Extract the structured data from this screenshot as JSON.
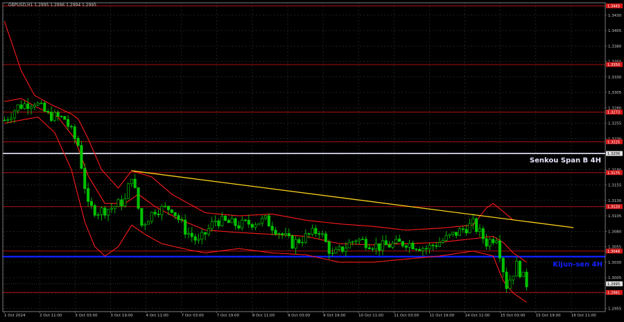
{
  "header": {
    "symbol_line": "GBPUSD,H1  1.2995 1.2996 1.2994 1.2995"
  },
  "colors": {
    "background": "#000000",
    "grid": "#2e3a2e",
    "axis": "#9a9a9a",
    "text": "#c8c8c8",
    "bull": "#00e000",
    "bear": "#00c000",
    "bollinger": "#ff1a1a",
    "level_line": "#b01010",
    "trend_line": "#ffd21a",
    "senkou": "#e6e6ff",
    "kijun": "#1020ff",
    "current_price_bg": "#e0e0e0",
    "level_label_bg": "#d01818"
  },
  "chart_data": {
    "type": "candlestick",
    "title": "GBPUSD,H1",
    "ylim": [
      1.295,
      1.345
    ],
    "y_ticks": [
      "1.3430",
      "1.3405",
      "1.3380",
      "1.3355",
      "1.3330",
      "1.3305",
      "1.3280",
      "1.3255",
      "1.3230",
      "1.3205",
      "1.3180",
      "1.3155",
      "1.3130",
      "1.3105",
      "1.3080",
      "1.3055",
      "1.3030",
      "1.3005",
      "1.2980",
      "1.2955"
    ],
    "x_ticks": [
      "1 Oct 2024",
      "2 Oct 11:00",
      "3 Oct 03:00",
      "3 Oct 19:00",
      "4 Oct 11:00",
      "7 Oct 03:00",
      "7 Oct 19:00",
      "8 Oct 11:00",
      "9 Oct 03:00",
      "9 Oct 19:00",
      "10 Oct 11:00",
      "11 Oct 03:00",
      "11 Oct 19:00",
      "14 Oct 11:00",
      "15 Oct 03:00",
      "15 Oct 19:00",
      "16 Oct 11:00"
    ],
    "levels": [
      {
        "price": 1.3445,
        "label": "1.3445"
      },
      {
        "price": 1.335,
        "label": "1.3350"
      },
      {
        "price": 1.3273,
        "label": "1.3273"
      },
      {
        "price": 1.3225,
        "label": "1.3225"
      },
      {
        "price": 1.3175,
        "label": "1.3175"
      },
      {
        "price": 1.312,
        "label": "1.3120"
      },
      {
        "price": 1.3048,
        "label": "1.3048"
      },
      {
        "price": 1.2981,
        "label": "1.2981"
      }
    ],
    "senkou_span_b": {
      "price": 1.3206,
      "name": "Senkou Span B 4H",
      "label": "1.3206"
    },
    "kijun_sen": {
      "price": 1.3039,
      "name": "Kijun-sen 4H"
    },
    "current_price": "1.2995",
    "trend_line": [
      {
        "i": 38,
        "p": 1.3178
      },
      {
        "i": 170,
        "p": 1.3086
      }
    ],
    "n_bars": 180,
    "close_anchors": [
      [
        0,
        1.326
      ],
      [
        4,
        1.3282
      ],
      [
        9,
        1.329
      ],
      [
        13,
        1.3268
      ],
      [
        18,
        1.3262
      ],
      [
        22,
        1.322
      ],
      [
        25,
        1.312
      ],
      [
        28,
        1.3112
      ],
      [
        32,
        1.3118
      ],
      [
        36,
        1.313
      ],
      [
        38,
        1.3172
      ],
      [
        41,
        1.309
      ],
      [
        45,
        1.3115
      ],
      [
        50,
        1.3118
      ],
      [
        54,
        1.3082
      ],
      [
        58,
        1.3062
      ],
      [
        63,
        1.3098
      ],
      [
        70,
        1.309
      ],
      [
        78,
        1.3098
      ],
      [
        86,
        1.306
      ],
      [
        94,
        1.3082
      ],
      [
        98,
        1.304
      ],
      [
        105,
        1.3068
      ],
      [
        112,
        1.3055
      ],
      [
        120,
        1.3062
      ],
      [
        126,
        1.3052
      ],
      [
        132,
        1.3068
      ],
      [
        140,
        1.3092
      ],
      [
        144,
        1.3062
      ],
      [
        147,
        1.3072
      ],
      [
        150,
        1.2992
      ],
      [
        153,
        1.3025
      ],
      [
        156,
        1.2995
      ]
    ],
    "bollinger_upper": [
      [
        0,
        1.342
      ],
      [
        5,
        1.334
      ],
      [
        9,
        1.33
      ],
      [
        14,
        1.3285
      ],
      [
        20,
        1.327
      ],
      [
        22,
        1.3262
      ],
      [
        25,
        1.323
      ],
      [
        29,
        1.318
      ],
      [
        34,
        1.315
      ],
      [
        38,
        1.3178
      ],
      [
        44,
        1.3168
      ],
      [
        50,
        1.314
      ],
      [
        55,
        1.3125
      ],
      [
        60,
        1.311
      ],
      [
        70,
        1.3105
      ],
      [
        80,
        1.3108
      ],
      [
        90,
        1.3098
      ],
      [
        100,
        1.3092
      ],
      [
        110,
        1.3088
      ],
      [
        120,
        1.3082
      ],
      [
        130,
        1.3085
      ],
      [
        140,
        1.309
      ],
      [
        144,
        1.3118
      ],
      [
        146,
        1.3125
      ],
      [
        149,
        1.3112
      ],
      [
        152,
        1.3098
      ]
    ],
    "bollinger_lower": [
      [
        0,
        1.3255
      ],
      [
        5,
        1.326
      ],
      [
        10,
        1.3265
      ],
      [
        15,
        1.324
      ],
      [
        20,
        1.318
      ],
      [
        24,
        1.3095
      ],
      [
        27,
        1.3055
      ],
      [
        30,
        1.304
      ],
      [
        34,
        1.3055
      ],
      [
        38,
        1.309
      ],
      [
        42,
        1.3075
      ],
      [
        47,
        1.306
      ],
      [
        55,
        1.305
      ],
      [
        60,
        1.3045
      ],
      [
        70,
        1.3052
      ],
      [
        80,
        1.3045
      ],
      [
        90,
        1.3042
      ],
      [
        100,
        1.303
      ],
      [
        110,
        1.303
      ],
      [
        120,
        1.3035
      ],
      [
        130,
        1.304
      ],
      [
        140,
        1.3048
      ],
      [
        146,
        1.304
      ],
      [
        149,
        1.3
      ],
      [
        152,
        1.298
      ],
      [
        156,
        1.2965
      ]
    ],
    "bollinger_middle": [
      [
        0,
        1.329
      ],
      [
        5,
        1.3295
      ],
      [
        10,
        1.328
      ],
      [
        16,
        1.3265
      ],
      [
        21,
        1.323
      ],
      [
        25,
        1.317
      ],
      [
        30,
        1.3125
      ],
      [
        36,
        1.3125
      ],
      [
        40,
        1.314
      ],
      [
        45,
        1.312
      ],
      [
        52,
        1.31
      ],
      [
        60,
        1.3082
      ],
      [
        70,
        1.3078
      ],
      [
        80,
        1.3075
      ],
      [
        90,
        1.3072
      ],
      [
        100,
        1.306
      ],
      [
        110,
        1.3058
      ],
      [
        120,
        1.306
      ],
      [
        130,
        1.3062
      ],
      [
        140,
        1.3068
      ],
      [
        146,
        1.3072
      ],
      [
        149,
        1.3062
      ],
      [
        152,
        1.3045
      ],
      [
        156,
        1.303
      ]
    ]
  }
}
